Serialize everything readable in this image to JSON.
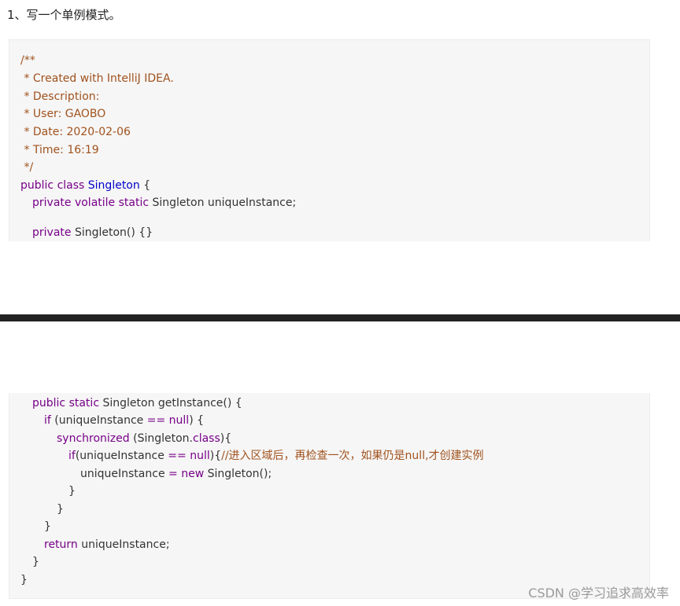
{
  "heading": "1、写一个单例模式。",
  "code_top": {
    "c1": "/**",
    "c2": " * Created with IntelliJ IDEA.",
    "c3": " * Description:",
    "c4": " * User: GAOBO",
    "c5": " * Date: 2020-02-06",
    "c6": " * Time: 16:19",
    "c7": " */",
    "kw_public_class": "public class ",
    "class_name": "Singleton",
    "brace_open": " {",
    "kw_private_volatile_static": "private volatile static ",
    "field_decl": "Singleton uniqueInstance;",
    "kw_private": "private ",
    "ctor": "Singleton() {}"
  },
  "code_bottom": {
    "kw_public_static": "public static ",
    "method_sig": "Singleton getInstance() {",
    "kw_if": "if ",
    "cond_open": "(uniqueInstance ",
    "op_eq": "==",
    "space": " ",
    "kw_null": "null",
    "cond_close": ") {",
    "kw_synchronized": "synchronized ",
    "sync_open": "(Singleton.",
    "kw_class": "class",
    "sync_close": "){",
    "kw_if2": "if",
    "cond2_open": "(uniqueInstance ",
    "op_eq2": "==",
    "space2": " ",
    "kw_null2": "null",
    "cond2_close": "){",
    "comment": "//进入区域后，再检查一次，如果仍是null,才创建实例",
    "assign_lhs": "uniqueInstance ",
    "op_assign": "=",
    "space3": " ",
    "kw_new": "new",
    "assign_rhs": " Singleton();",
    "close_brace_1": "}",
    "close_brace_2": "}",
    "close_brace_3": "}",
    "kw_return": "return ",
    "return_val": "uniqueInstance;",
    "close_brace_4": "}",
    "close_brace_5": "}"
  },
  "watermark": "CSDN @学习追求高效率",
  "colors": {
    "comment": "#a0521d",
    "keyword": "#770088",
    "type": "#0000cc",
    "code_bg": "#f6f6f6",
    "divider": "#222222"
  }
}
